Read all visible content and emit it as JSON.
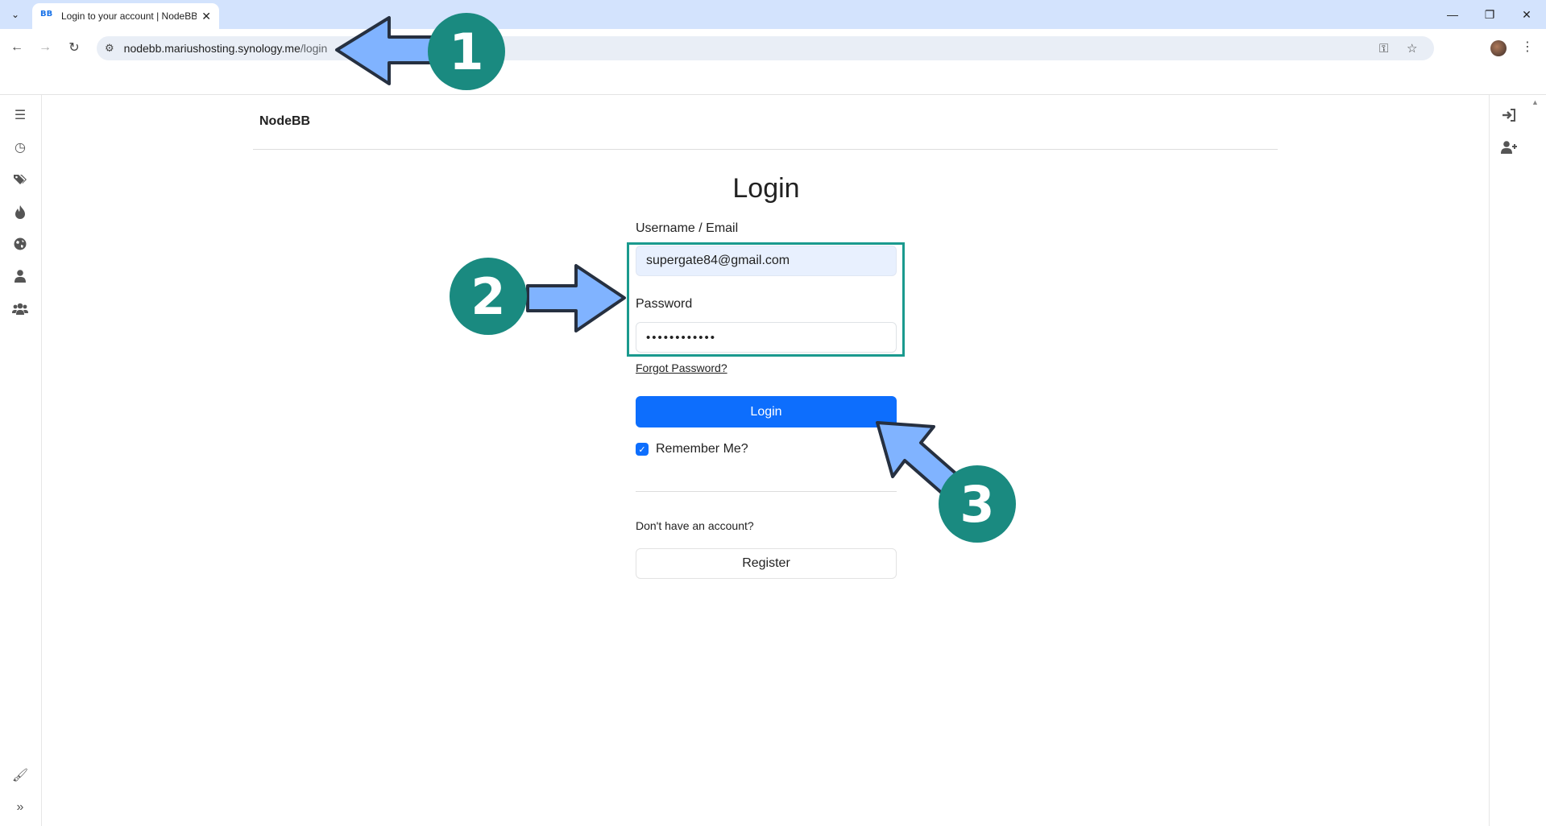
{
  "browser": {
    "tab_title": "Login to your account | NodeBB",
    "tab_favicon": "BB",
    "url_host": "nodebb.mariushosting.synology.me",
    "url_path": "/login"
  },
  "site": {
    "brand": "NodeBB"
  },
  "left_rail": {
    "icons": [
      "list-icon",
      "clock-icon",
      "tags-icon",
      "fire-icon",
      "globe-icon",
      "user-icon",
      "users-icon",
      "paintbrush-icon",
      "expand-icon"
    ]
  },
  "right_rail": {
    "icons": [
      "sign-in-icon",
      "user-plus-icon"
    ]
  },
  "login": {
    "title": "Login",
    "username_label": "Username / Email",
    "username_value": "supergate84@gmail.com",
    "password_label": "Password",
    "password_value": "••••••••••••",
    "forgot_link": "Forgot Password?",
    "login_button": "Login",
    "remember_label": "Remember Me?",
    "remember_checked": true,
    "no_account_text": "Don't have an account?",
    "register_button": "Register"
  },
  "annotations": {
    "step_1": "1",
    "step_2": "2",
    "step_3": "3",
    "arrow_color": "#80b3ff",
    "badge_color": "#1a8a80"
  }
}
